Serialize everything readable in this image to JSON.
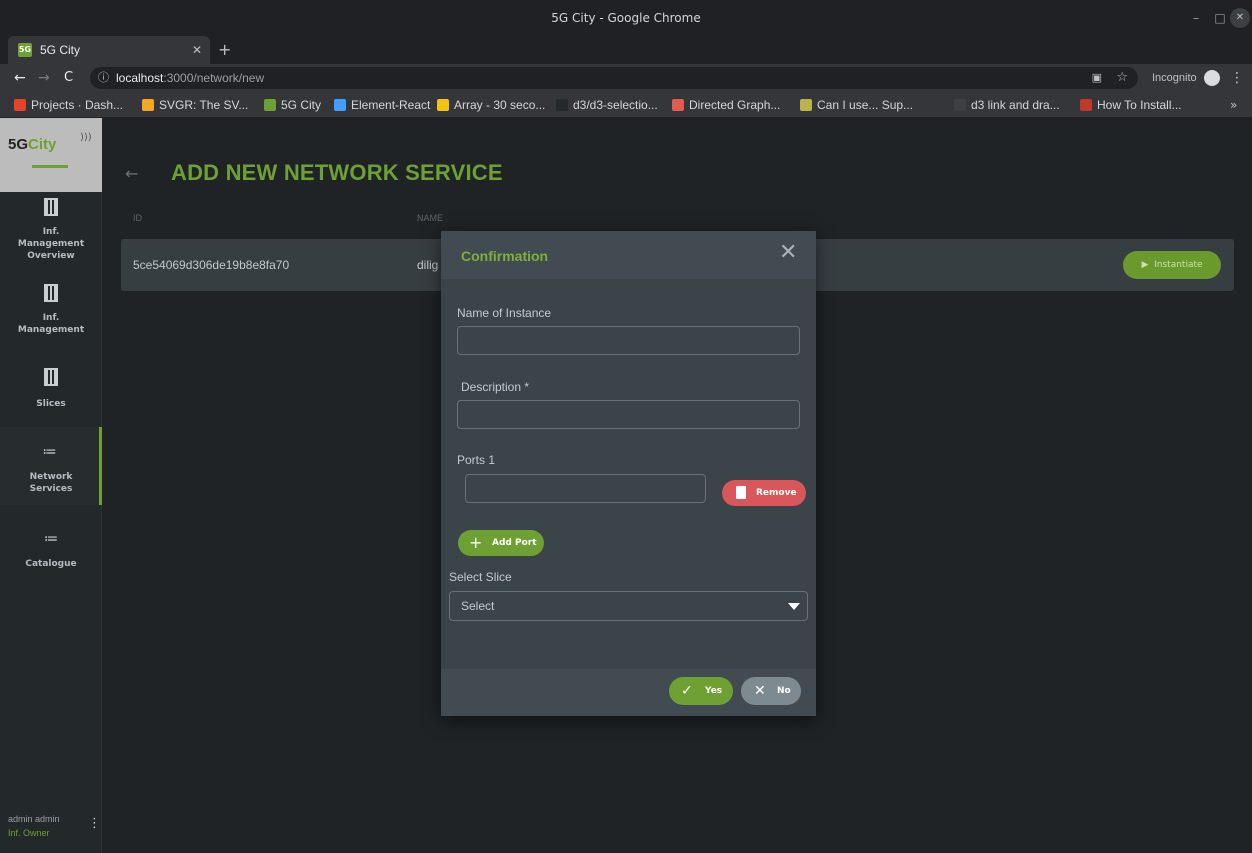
{
  "window": {
    "title": "5G City - Google Chrome",
    "controls": {
      "minimize": "–",
      "maximize": "□",
      "close": "✕"
    }
  },
  "tab": {
    "label": "5G City",
    "close": "✕",
    "new_tab": "+"
  },
  "toolbar": {
    "back": "←",
    "forward": "→",
    "reload": "C",
    "info_icon": "ⓘ",
    "url_host": "localhost",
    "url_path": ":3000/network/new",
    "incognito_label": "Incognito",
    "menu": "⋮"
  },
  "bookmarks": [
    {
      "label": "Projects · Dash...",
      "color": "#e2432a"
    },
    {
      "label": "SVGR: The SV...",
      "color": "#f5a623"
    },
    {
      "label": "5G City",
      "color": "#6fa033"
    },
    {
      "label": "Element-React",
      "color": "#409eff"
    },
    {
      "label": "Array - 30 seco...",
      "color": "#f1c40f"
    },
    {
      "label": "d3/d3-selectio...",
      "color": "#24292e"
    },
    {
      "label": "Directed Graph...",
      "color": "#e35b4d"
    },
    {
      "label": "Can I use... Sup...",
      "color": "#b9b34a"
    },
    {
      "label": "d3 link and dra...",
      "color": "#3c4043"
    },
    {
      "label": "How To Install...",
      "color": "#c0392b"
    }
  ],
  "bookmarks_more": "»",
  "app": {
    "logo_text_a": "5G",
    "logo_text_b": "City",
    "nav": [
      {
        "label": "Inf. Management Overview",
        "icon": "map-icon",
        "active": false
      },
      {
        "label": "Inf. Management",
        "icon": "map-icon",
        "active": false
      },
      {
        "label": "Slices",
        "icon": "map-icon",
        "active": false
      },
      {
        "label": "Network Services",
        "icon": "list-icon",
        "active": true
      },
      {
        "label": "Catalogue",
        "icon": "list-icon",
        "active": false
      }
    ],
    "user": {
      "name": "admin admin",
      "role": "Inf. Owner",
      "menu": "⋮"
    }
  },
  "main": {
    "back": "←",
    "title": "ADD NEW NETWORK SERVICE",
    "columns": {
      "id": "ID",
      "name": "NAME"
    },
    "row": {
      "id": "5ce54069d306de19b8e8fa70",
      "name": "dilig",
      "action": "Instantiate",
      "action_icon": "▶"
    }
  },
  "modal": {
    "title": "Confirmation",
    "close": "✕",
    "name_label": "Name of Instance",
    "name_value": "",
    "description_label": "Description *",
    "description_value": "",
    "ports_label": "Ports 1",
    "port_value": "",
    "remove_label": "Remove",
    "add_port_label": "Add Port",
    "add_port_icon": "+",
    "slice_label": "Select Slice",
    "slice_value": "Select",
    "yes_label": "Yes",
    "yes_icon": "✓",
    "no_label": "No",
    "no_icon": "✕"
  },
  "colors": {
    "accent": "#6fa033",
    "danger": "#d9565b",
    "modal_bg": "#3b4449",
    "row_bg": "#373e42"
  }
}
